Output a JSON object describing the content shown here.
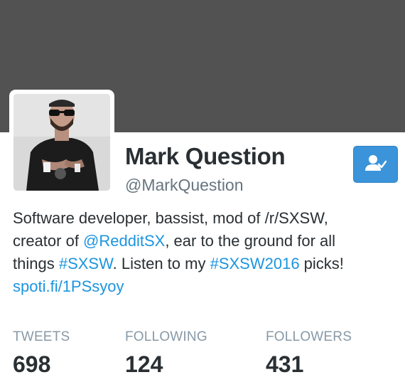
{
  "profile": {
    "name": "Mark Question",
    "handle": "@MarkQuestion"
  },
  "follow_button": {
    "icon": "following-user-icon",
    "color": "#3b94d9"
  },
  "bio": {
    "line1": "Software developer, bassist, mod of /r/SXSW,",
    "line2_prefix": "creator of ",
    "line2_mention": "@RedditSX",
    "line2_suffix": ", ear to the ground for all",
    "line3_prefix": "things ",
    "line3_hashtag1": "#SXSW",
    "line3_middle": ". Listen to my ",
    "line3_hashtag2": "#SXSW2016",
    "line3_suffix": " picks!",
    "link": "spoti.fi/1PSsyoy"
  },
  "stats": [
    {
      "label": "TWEETS",
      "value": "698"
    },
    {
      "label": "FOLLOWING",
      "value": "124"
    },
    {
      "label": "FOLLOWERS",
      "value": "431"
    }
  ],
  "colors": {
    "banner": "#525252",
    "link": "#1b95e0",
    "muted": "#8899a6"
  }
}
